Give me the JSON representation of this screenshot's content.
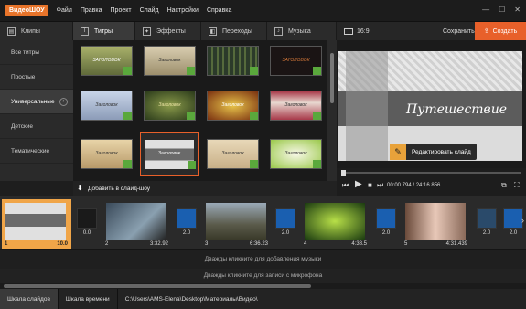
{
  "menu": {
    "logo": "ВидеоШОУ",
    "items": [
      "Файл",
      "Правка",
      "Проект",
      "Слайд",
      "Настройки",
      "Справка"
    ]
  },
  "tabs": [
    {
      "label": "Клипы",
      "icon": "film-icon"
    },
    {
      "label": "Титры",
      "icon": "text-icon"
    },
    {
      "label": "Эффекты",
      "icon": "effects-icon"
    },
    {
      "label": "Переходы",
      "icon": "transition-icon"
    },
    {
      "label": "Музыка",
      "icon": "music-icon"
    }
  ],
  "toolbar": {
    "ratio": "16:9",
    "save_label": "Сохранить",
    "create_label": "Создать"
  },
  "sidebar": {
    "items": [
      "Все титры",
      "Простые",
      "Универсальные",
      "Детские",
      "Тематические"
    ]
  },
  "grid": {
    "thumbs": [
      {
        "label": "ЗАГОЛОВОК"
      },
      {
        "label": "Заголовок"
      },
      {
        "label": ""
      },
      {
        "label": "ЗАГОЛОВОК"
      },
      {
        "label": "Заголовок"
      },
      {
        "label": "Заголовок"
      },
      {
        "label": "Заголовок"
      },
      {
        "label": "Заголовок"
      },
      {
        "label": "Заголовок"
      },
      {
        "label": "Заголовок"
      },
      {
        "label": "Заголовок"
      },
      {
        "label": "Заголовок"
      }
    ]
  },
  "preview": {
    "title": "Путешествие",
    "edit_label": "Редактировать слайд",
    "time": "00:00.794 / 24:16.856"
  },
  "addbar": {
    "label": "Добавить в слайд-шоу"
  },
  "slides": [
    {
      "num": "1",
      "dur": "10.0"
    },
    {
      "num": "2",
      "dur": "3:32.92"
    },
    {
      "num": "3",
      "dur": "6:36.23"
    },
    {
      "num": "4",
      "dur": "4:38.5"
    },
    {
      "num": "5",
      "dur": "4:31.439"
    }
  ],
  "transitions": [
    {
      "dur": "0.0"
    },
    {
      "dur": "2.0"
    },
    {
      "dur": "2.0"
    },
    {
      "dur": "2.0"
    },
    {
      "dur": "2.0"
    },
    {
      "dur": "2.0"
    }
  ],
  "audio": {
    "music_hint": "Дважды кликните для добавления музыки",
    "mic_hint": "Дважды кликните для записи с микрофона"
  },
  "status": {
    "storyboard": "Шкала слайдов",
    "timeline": "Шкала времени",
    "path": "C:\\Users\\AMS-Elena\\Desktop\\Материалы\\Видео\\"
  },
  "colors": {
    "accent": "#e8602a",
    "active_slide": "#f0a548",
    "add_badge": "#5aa83c",
    "transition_blue": "#1a5fb0"
  }
}
